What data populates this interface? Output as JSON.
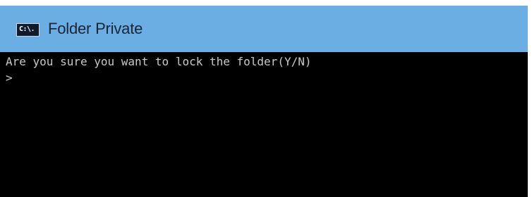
{
  "window": {
    "title": "Folder Private",
    "icon": {
      "name": "command-prompt-icon",
      "glyph": "C:\\."
    }
  },
  "console": {
    "lines": [
      "Are you sure you want to lock the folder(Y/N)",
      ">"
    ]
  },
  "colors": {
    "titlebar": "#6aaee3",
    "console_background": "#000000",
    "console_text": "#c8c8c8"
  }
}
